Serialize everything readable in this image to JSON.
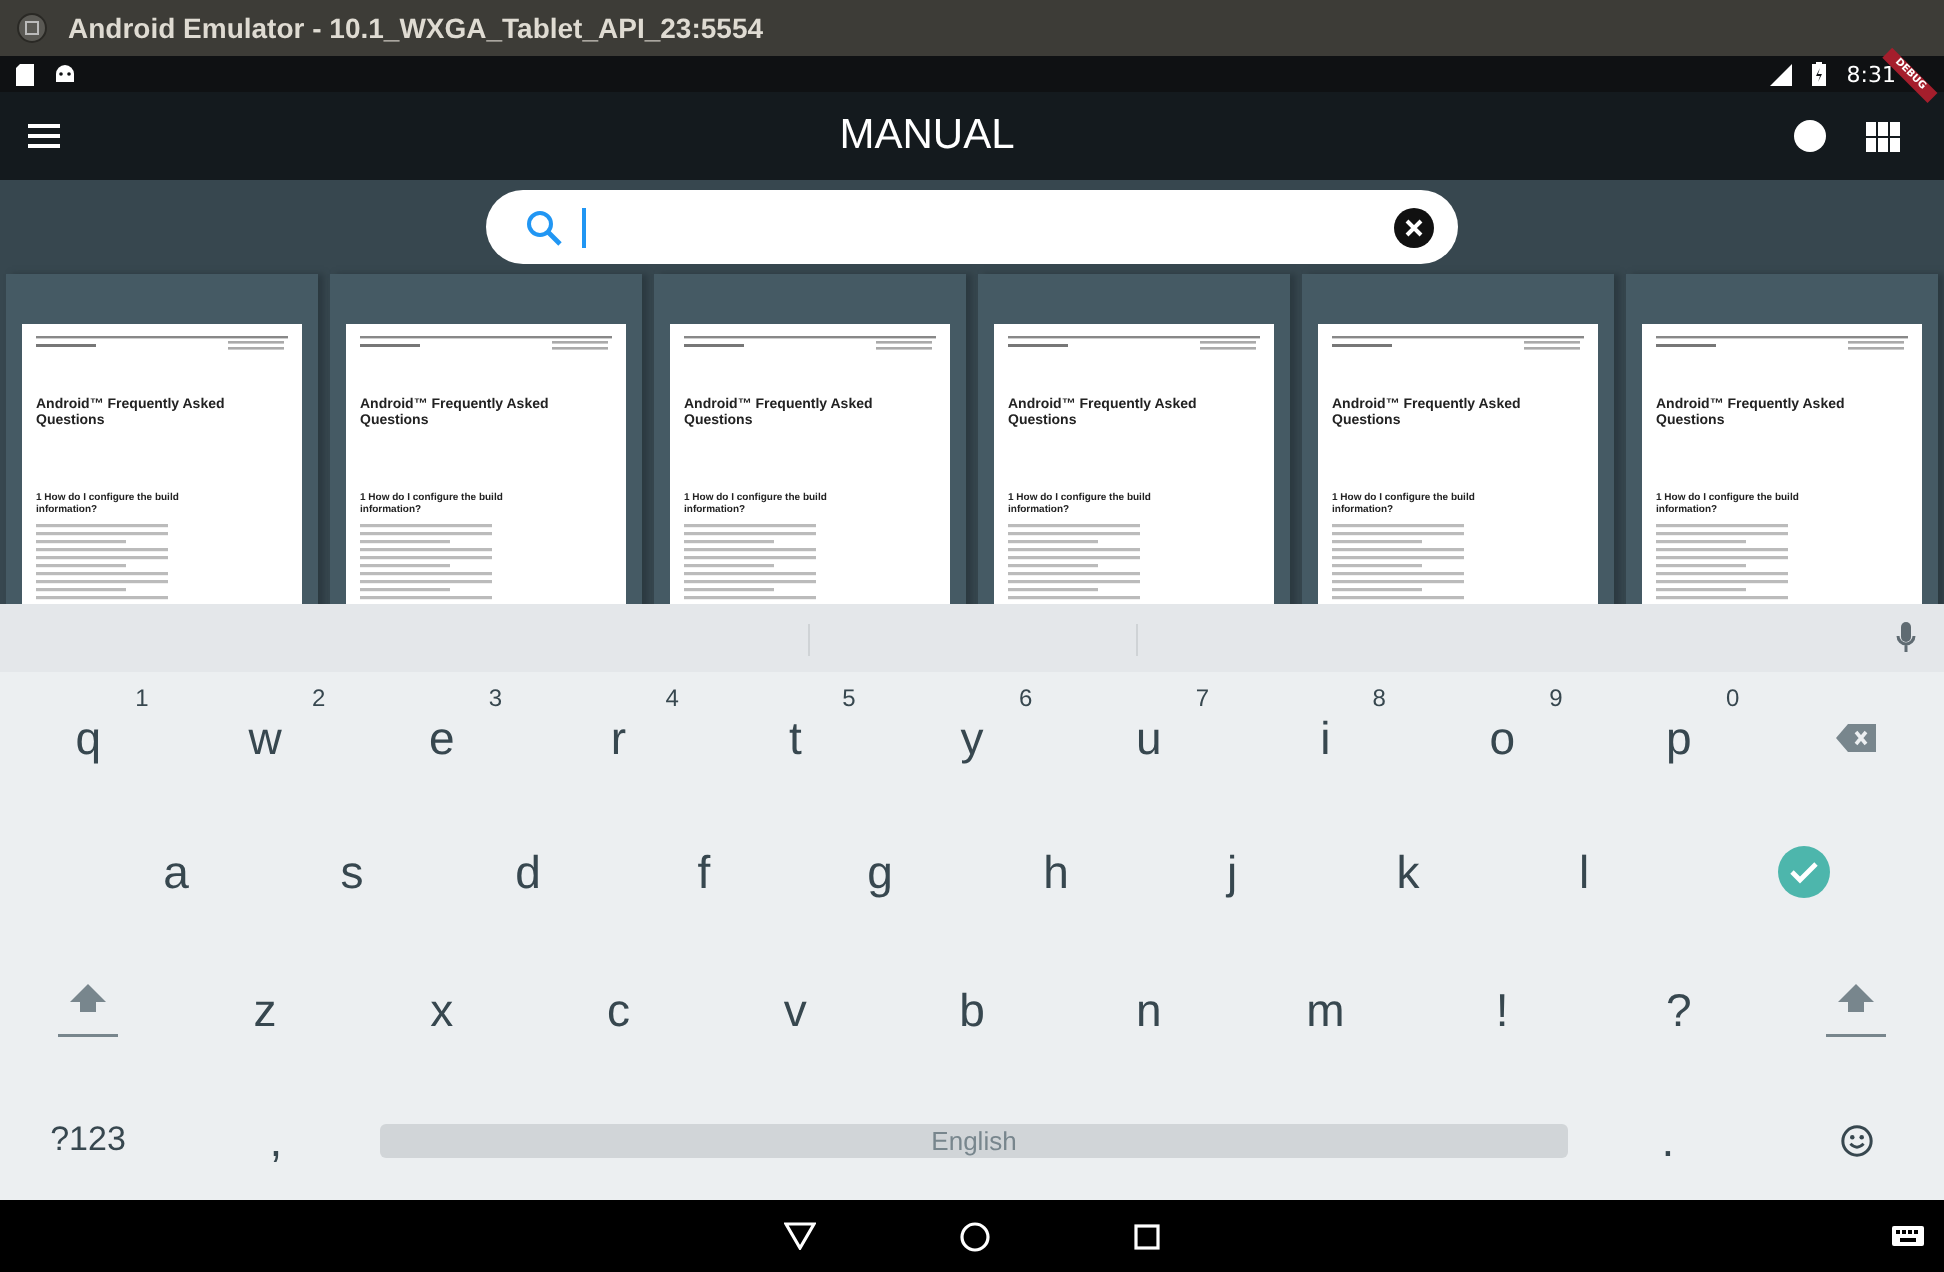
{
  "window": {
    "title": "Android Emulator - 10.1_WXGA_Tablet_API_23:5554"
  },
  "status_bar": {
    "time": "8:31",
    "debug_banner": "DEBUG"
  },
  "app_bar": {
    "title": "MANUAL"
  },
  "search": {
    "cursor": true
  },
  "documents": [
    {
      "title": "Android™ Frequently Asked Questions",
      "section_number": "1",
      "section_title": "How do I configure the build information?"
    },
    {
      "title": "Android™ Frequently Asked Questions",
      "section_number": "1",
      "section_title": "How do I configure the build information?"
    },
    {
      "title": "Android™ Frequently Asked Questions",
      "section_number": "1",
      "section_title": "How do I configure the build information?"
    },
    {
      "title": "Android™ Frequently Asked Questions",
      "section_number": "1",
      "section_title": "How do I configure the build information?"
    },
    {
      "title": "Android™ Frequently Asked Questions",
      "section_number": "1",
      "section_title": "How do I configure the build information?"
    },
    {
      "title": "Android™ Frequently Asked Questions",
      "section_number": "1",
      "section_title": "How do I configure the build information?"
    }
  ],
  "keyboard": {
    "key_rows": [
      {
        "keys": [
          {
            "kind": "letter",
            "label": "q",
            "hint": "1"
          },
          {
            "kind": "letter",
            "label": "w",
            "hint": "2"
          },
          {
            "kind": "letter",
            "label": "e",
            "hint": "3"
          },
          {
            "kind": "letter",
            "label": "r",
            "hint": "4"
          },
          {
            "kind": "letter",
            "label": "t",
            "hint": "5"
          },
          {
            "kind": "letter",
            "label": "y",
            "hint": "6"
          },
          {
            "kind": "letter",
            "label": "u",
            "hint": "7"
          },
          {
            "kind": "letter",
            "label": "i",
            "hint": "8"
          },
          {
            "kind": "letter",
            "label": "o",
            "hint": "9"
          },
          {
            "kind": "letter",
            "label": "p",
            "hint": "0"
          },
          {
            "kind": "backspace"
          }
        ]
      },
      {
        "keys": [
          {
            "kind": "letter",
            "label": "a"
          },
          {
            "kind": "letter",
            "label": "s"
          },
          {
            "kind": "letter",
            "label": "d"
          },
          {
            "kind": "letter",
            "label": "f"
          },
          {
            "kind": "letter",
            "label": "g"
          },
          {
            "kind": "letter",
            "label": "h"
          },
          {
            "kind": "letter",
            "label": "j"
          },
          {
            "kind": "letter",
            "label": "k"
          },
          {
            "kind": "letter",
            "label": "l"
          },
          {
            "kind": "enter"
          }
        ]
      },
      {
        "keys": [
          {
            "kind": "shift"
          },
          {
            "kind": "letter",
            "label": "z"
          },
          {
            "kind": "letter",
            "label": "x"
          },
          {
            "kind": "letter",
            "label": "c"
          },
          {
            "kind": "letter",
            "label": "v"
          },
          {
            "kind": "letter",
            "label": "b"
          },
          {
            "kind": "letter",
            "label": "n"
          },
          {
            "kind": "letter",
            "label": "m"
          },
          {
            "kind": "letter",
            "label": "!"
          },
          {
            "kind": "letter",
            "label": "?"
          },
          {
            "kind": "shift"
          }
        ]
      },
      {
        "keys": [
          {
            "kind": "symbols",
            "label": "?123"
          },
          {
            "kind": "letter",
            "label": ","
          },
          {
            "kind": "space",
            "label": "English"
          },
          {
            "kind": "letter",
            "label": "."
          },
          {
            "kind": "emoji"
          }
        ]
      }
    ]
  }
}
